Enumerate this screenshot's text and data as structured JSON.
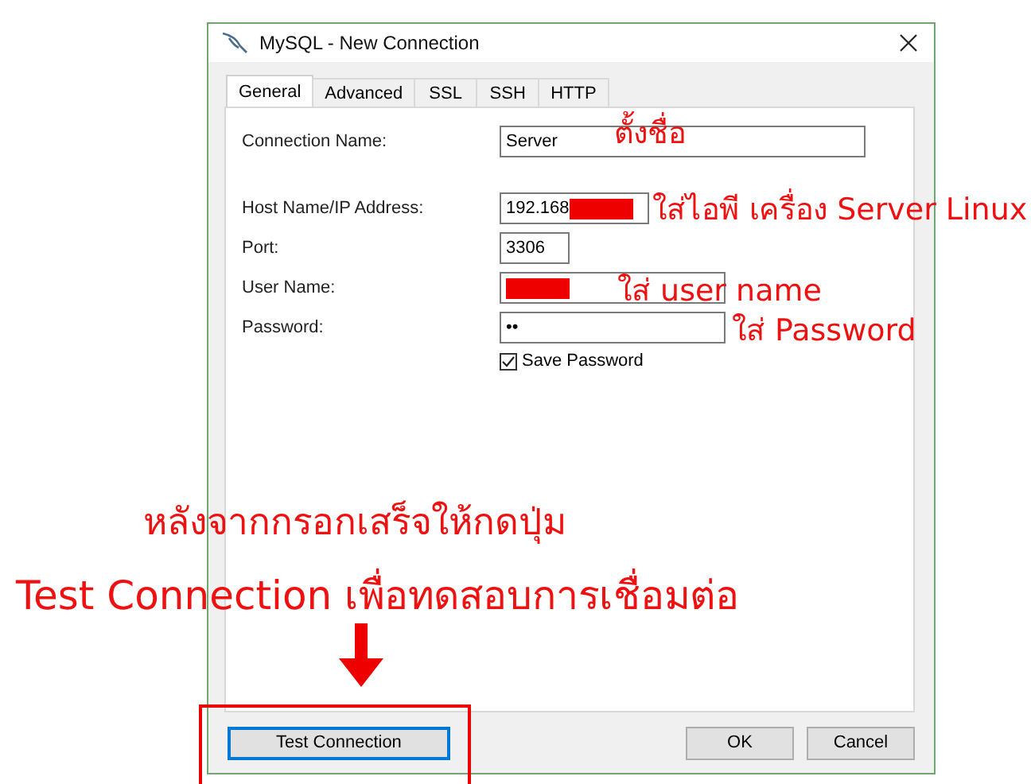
{
  "window": {
    "title": "MySQL - New Connection"
  },
  "tabs": [
    {
      "label": "General",
      "selected": true
    },
    {
      "label": "Advanced",
      "selected": false
    },
    {
      "label": "SSL",
      "selected": false
    },
    {
      "label": "SSH",
      "selected": false
    },
    {
      "label": "HTTP",
      "selected": false
    }
  ],
  "fields": [
    {
      "label": "Connection Name:",
      "value": "Server",
      "kind": "wide",
      "redacted": false
    },
    {
      "label": "Host Name/IP Address:",
      "value": "192.168",
      "kind": "ip",
      "redacted": true
    },
    {
      "label": "Port:",
      "value": "3306",
      "kind": "port",
      "redacted": false
    },
    {
      "label": "User Name:",
      "kind": "medium",
      "redacted": true
    },
    {
      "label": "Password:",
      "value": "••",
      "kind": "medium",
      "redacted": false
    }
  ],
  "save_password": {
    "label": "Save Password",
    "checked": true
  },
  "buttons": [
    {
      "label": "Test Connection",
      "focused": true
    },
    {
      "label": "OK",
      "focused": false
    },
    {
      "label": "Cancel",
      "focused": false
    }
  ],
  "annotations": [
    {
      "text": "ตั้งชื่อ"
    },
    {
      "text": "ใส่ไอพี เครื่อง Server Linux"
    },
    {
      "text": "ใส่  user name"
    },
    {
      "text": "ใส่ Password"
    },
    {
      "text": "หลังจากกรอกเสร็จให้กดปุ่ม"
    },
    {
      "text": "Test Connection เพื่อทดสอบการเชื่อมต่อ"
    }
  ]
}
